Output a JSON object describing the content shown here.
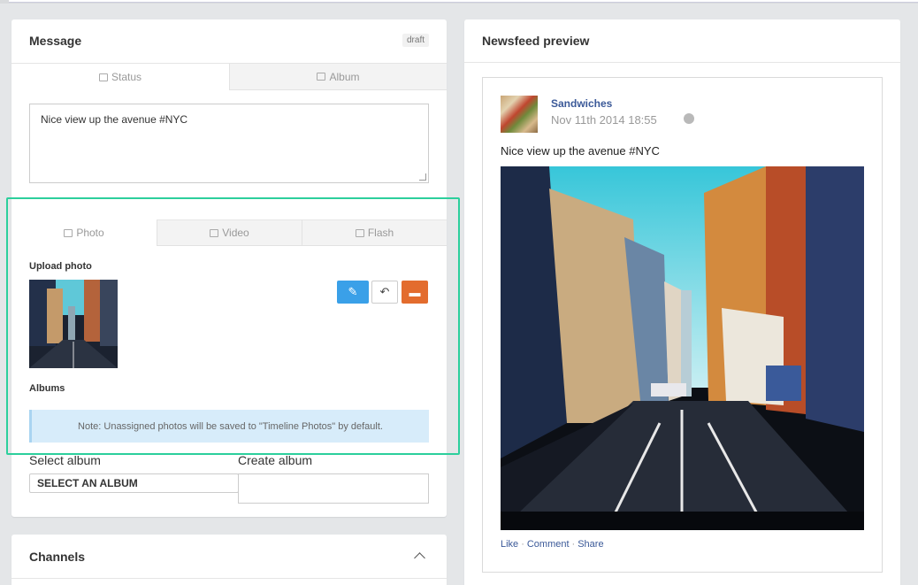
{
  "message": {
    "title": "Message",
    "draft_badge": "draft",
    "tabs": [
      {
        "label": "Status",
        "icon": "document-icon"
      },
      {
        "label": "Album",
        "icon": "image-icon"
      }
    ],
    "status_text": "Nice view up the avenue #NYC",
    "media_tabs": [
      {
        "label": "Photo",
        "icon": "image-icon"
      },
      {
        "label": "Video",
        "icon": "film-icon"
      },
      {
        "label": "Flash",
        "icon": "film-icon"
      }
    ],
    "upload_label": "Upload photo",
    "albums_label": "Albums",
    "note": "Note: Unassigned photos will be saved to \"Timeline Photos\" by default.",
    "select_album_label": "Select album",
    "select_album_value": "SELECT AN ALBUM",
    "create_album_label": "Create album",
    "create_album_value": ""
  },
  "channels": {
    "title": "Channels"
  },
  "newsfeed": {
    "title": "Newsfeed preview",
    "page_name": "Sandwiches",
    "date": "Nov 11th 2014 18:55",
    "post_text": "Nice view up the avenue #NYC",
    "actions": [
      "Like",
      "Comment",
      "Share"
    ]
  },
  "colors": {
    "accent_blue": "#3aa0e8",
    "danger_orange": "#e36c2e",
    "highlight_green": "#2ccf9c",
    "link_blue": "#3b5998",
    "note_bg": "#d7ecfa"
  }
}
